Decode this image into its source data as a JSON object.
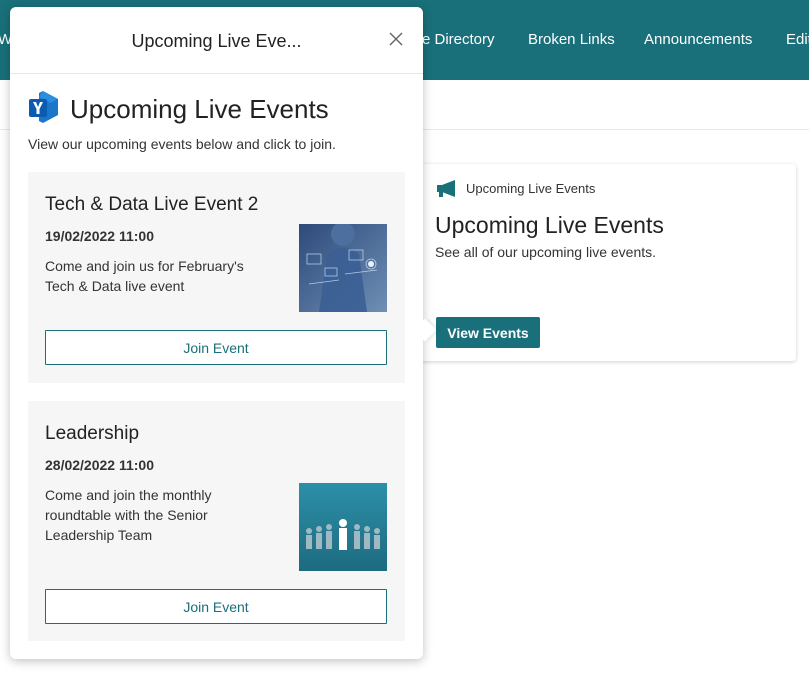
{
  "nav": {
    "items": [
      "Wh",
      "e Directory",
      "Broken Links",
      "Announcements",
      "Edit"
    ]
  },
  "panel": {
    "header_title": "Upcoming Live Eve...",
    "main_title": "Upcoming Live Events",
    "intro": "View our upcoming events below and click to join.",
    "events": [
      {
        "title": "Tech & Data Live Event 2",
        "date": "19/02/2022 11:00",
        "description": "Come and join us for February's Tech & Data live event",
        "join_label": "Join Event"
      },
      {
        "title": "Leadership",
        "date": "28/02/2022 11:00",
        "description": "Come and join the monthly roundtable with the Senior Leadership Team",
        "join_label": "Join Event"
      }
    ]
  },
  "webpart": {
    "eyebrow": "Upcoming Live Events",
    "title": "Upcoming Live Events",
    "description": "See all of our upcoming live events.",
    "button_label": "View Events"
  },
  "icons": {
    "app": "yammer-icon",
    "close": "close-icon",
    "megaphone": "megaphone-icon"
  },
  "colors": {
    "accent": "#19707a",
    "yammer_blue": "#0a64c2"
  }
}
